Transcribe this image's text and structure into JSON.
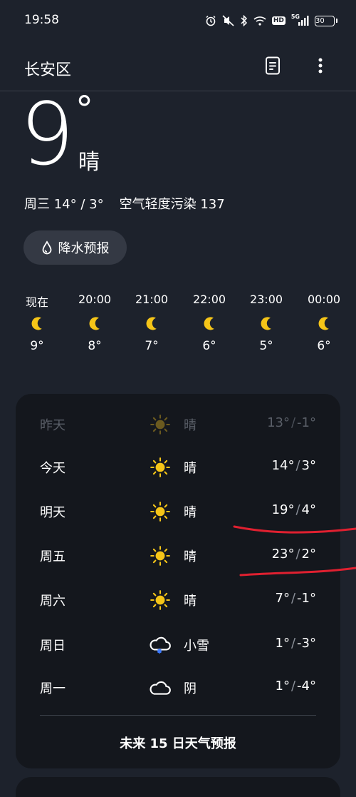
{
  "status_bar": {
    "time": "19:58",
    "hd_label": "HD",
    "network_label": "5G",
    "battery": "30"
  },
  "header": {
    "location": "长安区"
  },
  "current": {
    "temperature": "9",
    "degree_symbol": "°",
    "condition": "晴",
    "day_label": "周三",
    "high_low": "14° / 3°",
    "air_quality": "空气轻度污染 137"
  },
  "precip_button": {
    "label": "降水预报"
  },
  "hourly": [
    {
      "time": "现在",
      "icon": "moon-icon",
      "temp": "9°"
    },
    {
      "time": "20:00",
      "icon": "moon-icon",
      "temp": "8°"
    },
    {
      "time": "21:00",
      "icon": "moon-icon",
      "temp": "7°"
    },
    {
      "time": "22:00",
      "icon": "moon-icon",
      "temp": "6°"
    },
    {
      "time": "23:00",
      "icon": "moon-icon",
      "temp": "5°"
    },
    {
      "time": "00:00",
      "icon": "moon-icon",
      "temp": "6°"
    }
  ],
  "daily": [
    {
      "day": "昨天",
      "icon": "sun-icon",
      "condition": "晴",
      "high": "13°",
      "low": "-1°"
    },
    {
      "day": "今天",
      "icon": "sun-icon",
      "condition": "晴",
      "high": "14°",
      "low": "3°"
    },
    {
      "day": "明天",
      "icon": "sun-icon",
      "condition": "晴",
      "high": "19°",
      "low": "4°"
    },
    {
      "day": "周五",
      "icon": "sun-icon",
      "condition": "晴",
      "high": "23°",
      "low": "2°"
    },
    {
      "day": "周六",
      "icon": "sun-icon",
      "condition": "晴",
      "high": "7°",
      "low": "-1°"
    },
    {
      "day": "周日",
      "icon": "snow-cloud-icon",
      "condition": "小雪",
      "high": "1°",
      "low": "-3°"
    },
    {
      "day": "周一",
      "icon": "cloud-icon",
      "condition": "阴",
      "high": "1°",
      "low": "-4°"
    }
  ],
  "temp_separator": "/",
  "forecast_link": "未来 15 日天气预报",
  "colors": {
    "background": "#1d222c",
    "card": "#14171d",
    "sun": "#f5c518",
    "moon": "#f5c518",
    "snow_dot": "#3d7bff",
    "annotation_red": "#e02030"
  }
}
